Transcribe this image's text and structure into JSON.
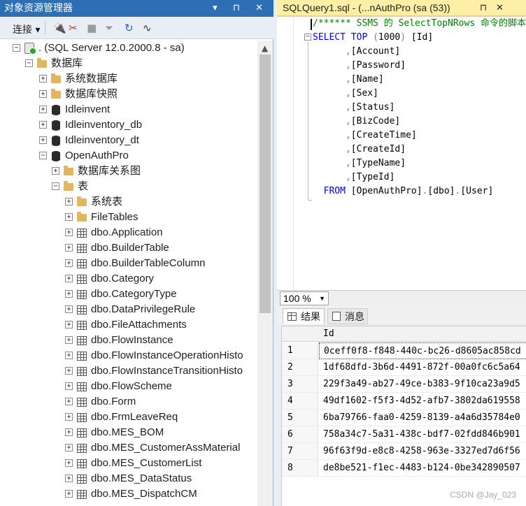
{
  "object_explorer": {
    "title": "对象资源管理器",
    "title_buttons": "▾ ⊓ ✕",
    "toolbar": {
      "connect": "连接 ▾",
      "icons": [
        "connect-plug-icon",
        "disconnect-icon",
        "stop-icon",
        "filter-icon",
        "refresh-icon",
        "activity-monitor-icon"
      ]
    },
    "tree": [
      {
        "label": ". (SQL Server 12.0.2000.8 - sa)",
        "level": 0,
        "expander": "−",
        "icon": "server-icon"
      },
      {
        "label": "数据库",
        "level": 1,
        "expander": "−",
        "icon": "folder-icon"
      },
      {
        "label": "系统数据库",
        "level": 2,
        "expander": "+",
        "icon": "folder-icon"
      },
      {
        "label": "数据库快照",
        "level": 2,
        "expander": "+",
        "icon": "folder-icon"
      },
      {
        "label": "Idleinvent",
        "level": 2,
        "expander": "+",
        "icon": "database-icon"
      },
      {
        "label": "Idleinventory_db",
        "level": 2,
        "expander": "+",
        "icon": "database-icon"
      },
      {
        "label": "Idleinventory_dt",
        "level": 2,
        "expander": "+",
        "icon": "database-icon"
      },
      {
        "label": "OpenAuthPro",
        "level": 2,
        "expander": "−",
        "icon": "database-icon"
      },
      {
        "label": "数据库关系图",
        "level": 3,
        "expander": "+",
        "icon": "folder-icon"
      },
      {
        "label": "表",
        "level": 3,
        "expander": "−",
        "icon": "folder-icon"
      },
      {
        "label": "系统表",
        "level": 4,
        "expander": "+",
        "icon": "folder-icon"
      },
      {
        "label": "FileTables",
        "level": 4,
        "expander": "+",
        "icon": "folder-icon"
      },
      {
        "label": "dbo.Application",
        "level": 4,
        "expander": "+",
        "icon": "table-icon"
      },
      {
        "label": "dbo.BuilderTable",
        "level": 4,
        "expander": "+",
        "icon": "table-icon"
      },
      {
        "label": "dbo.BuilderTableColumn",
        "level": 4,
        "expander": "+",
        "icon": "table-icon"
      },
      {
        "label": "dbo.Category",
        "level": 4,
        "expander": "+",
        "icon": "table-icon"
      },
      {
        "label": "dbo.CategoryType",
        "level": 4,
        "expander": "+",
        "icon": "table-icon"
      },
      {
        "label": "dbo.DataPrivilegeRule",
        "level": 4,
        "expander": "+",
        "icon": "table-icon"
      },
      {
        "label": "dbo.FileAttachments",
        "level": 4,
        "expander": "+",
        "icon": "table-icon"
      },
      {
        "label": "dbo.FlowInstance",
        "level": 4,
        "expander": "+",
        "icon": "table-icon"
      },
      {
        "label": "dbo.FlowInstanceOperationHisto",
        "level": 4,
        "expander": "+",
        "icon": "table-icon"
      },
      {
        "label": "dbo.FlowInstanceTransitionHisto",
        "level": 4,
        "expander": "+",
        "icon": "table-icon"
      },
      {
        "label": "dbo.FlowScheme",
        "level": 4,
        "expander": "+",
        "icon": "table-icon"
      },
      {
        "label": "dbo.Form",
        "level": 4,
        "expander": "+",
        "icon": "table-icon"
      },
      {
        "label": "dbo.FrmLeaveReq",
        "level": 4,
        "expander": "+",
        "icon": "table-icon"
      },
      {
        "label": "dbo.MES_BOM",
        "level": 4,
        "expander": "+",
        "icon": "table-icon"
      },
      {
        "label": "dbo.MES_CustomerAssMaterial",
        "level": 4,
        "expander": "+",
        "icon": "table-icon"
      },
      {
        "label": "dbo.MES_CustomerList",
        "level": 4,
        "expander": "+",
        "icon": "table-icon"
      },
      {
        "label": "dbo.MES_DataStatus",
        "level": 4,
        "expander": "+",
        "icon": "table-icon"
      },
      {
        "label": "dbo.MES_DispatchCM",
        "level": 4,
        "expander": "+",
        "icon": "table-icon"
      }
    ]
  },
  "query_tab": {
    "title": "SQLQuery1.sql - (...nAuthPro (sa (53))",
    "pin": "⊓",
    "close": "✕"
  },
  "editor": {
    "lines": [
      {
        "parts": [
          {
            "t": "/****** SSMS 的 SelectTopNRows 命令的脚本",
            "c": "cm"
          }
        ]
      },
      {
        "parts": [
          {
            "t": "SELECT TOP ",
            "c": "kw"
          },
          {
            "t": "(",
            "c": "gr"
          },
          {
            "t": "1000",
            "c": "tx"
          },
          {
            "t": ") ",
            "c": "gr"
          },
          {
            "t": "[Id]",
            "c": "tx"
          }
        ]
      },
      {
        "parts": [
          {
            "t": "      ,",
            "c": "gr"
          },
          {
            "t": "[Account]",
            "c": "tx"
          }
        ]
      },
      {
        "parts": [
          {
            "t": "      ,",
            "c": "gr"
          },
          {
            "t": "[Password]",
            "c": "tx"
          }
        ]
      },
      {
        "parts": [
          {
            "t": "      ,",
            "c": "gr"
          },
          {
            "t": "[Name]",
            "c": "tx"
          }
        ]
      },
      {
        "parts": [
          {
            "t": "      ,",
            "c": "gr"
          },
          {
            "t": "[Sex]",
            "c": "tx"
          }
        ]
      },
      {
        "parts": [
          {
            "t": "      ,",
            "c": "gr"
          },
          {
            "t": "[Status]",
            "c": "tx"
          }
        ]
      },
      {
        "parts": [
          {
            "t": "      ,",
            "c": "gr"
          },
          {
            "t": "[BizCode]",
            "c": "tx"
          }
        ]
      },
      {
        "parts": [
          {
            "t": "      ,",
            "c": "gr"
          },
          {
            "t": "[CreateTime]",
            "c": "tx"
          }
        ]
      },
      {
        "parts": [
          {
            "t": "      ,",
            "c": "gr"
          },
          {
            "t": "[CreateId]",
            "c": "tx"
          }
        ]
      },
      {
        "parts": [
          {
            "t": "      ,",
            "c": "gr"
          },
          {
            "t": "[TypeName]",
            "c": "tx"
          }
        ]
      },
      {
        "parts": [
          {
            "t": "      ,",
            "c": "gr"
          },
          {
            "t": "[TypeId]",
            "c": "tx"
          }
        ]
      },
      {
        "parts": [
          {
            "t": "  FROM ",
            "c": "kw"
          },
          {
            "t": "[OpenAuthPro]",
            "c": "tx"
          },
          {
            "t": ".",
            "c": "gr"
          },
          {
            "t": "[dbo]",
            "c": "tx"
          },
          {
            "t": ".",
            "c": "gr"
          },
          {
            "t": "[User]",
            "c": "tx"
          }
        ]
      }
    ]
  },
  "zoom": {
    "value": "100 %"
  },
  "results_tabs": [
    {
      "label": "结果",
      "icon": "grid-icon"
    },
    {
      "label": "消息",
      "icon": "message-icon"
    }
  ],
  "grid": {
    "columns": [
      "Id"
    ],
    "rows": [
      {
        "num": "1",
        "id": "0ceff0f8-f848-440c-bc26-d8605ac858cd"
      },
      {
        "num": "2",
        "id": "1df68dfd-3b6d-4491-872f-00a0fc6c5a64"
      },
      {
        "num": "3",
        "id": "229f3a49-ab27-49ce-b383-9f10ca23a9d5"
      },
      {
        "num": "4",
        "id": "49df1602-f5f3-4d52-afb7-3802da619558"
      },
      {
        "num": "5",
        "id": "6ba79766-faa0-4259-8139-a4a6d35784e0"
      },
      {
        "num": "6",
        "id": "758a34c7-5a31-438c-bdf7-02fdd846b901"
      },
      {
        "num": "7",
        "id": "96f63f9d-e8c8-4258-963e-3327ed7d6f56"
      },
      {
        "num": "8",
        "id": "de8be521-f1ec-4483-b124-0be342890507"
      }
    ]
  },
  "watermark": "CSDN @Jay_023",
  "colors": {
    "titlebar": "#2d6eb5",
    "query_tab": "#fdf0a6",
    "keyword": "#0000ff",
    "comment": "#008000"
  }
}
